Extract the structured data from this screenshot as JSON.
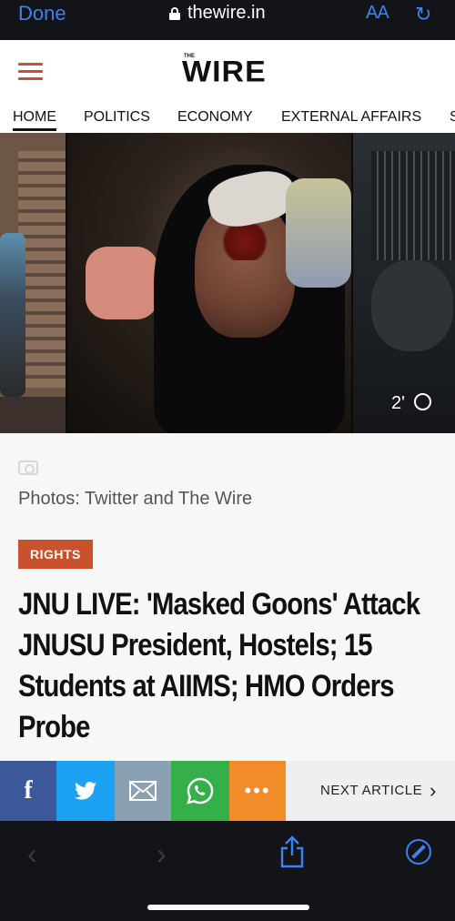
{
  "browser": {
    "done_label": "Done",
    "url": "thewire.in",
    "text_size_label": "AA",
    "reload_icon": "reload-icon"
  },
  "site": {
    "logo_small": "THE",
    "logo_text": "WIRE",
    "nav": [
      "HOME",
      "POLITICS",
      "ECONOMY",
      "EXTERNAL AFFAIRS",
      "S"
    ],
    "active_nav": "HOME"
  },
  "media": {
    "duration": "2'"
  },
  "article": {
    "photo_caption": "Photos: Twitter and The Wire",
    "category": "RIGHTS",
    "headline": "JNU LIVE: 'Masked Goons' Attack JNUSU President, Hostels; 15 Students at AIIMS; HMO Orders Probe"
  },
  "share_bar": {
    "facebook": "f",
    "more": "•••",
    "next_article": "NEXT ARTICLE",
    "next_chevron": "›",
    "colors": {
      "facebook": "#3b5998",
      "twitter": "#1da1f2",
      "mail": "#8aa1b3",
      "whatsapp": "#35b049",
      "more": "#f28c28"
    }
  },
  "toolbar": {
    "back": "‹",
    "forward": "›"
  },
  "theme": {
    "accent": "#c9512b",
    "ios_blue": "#3b82f6"
  }
}
